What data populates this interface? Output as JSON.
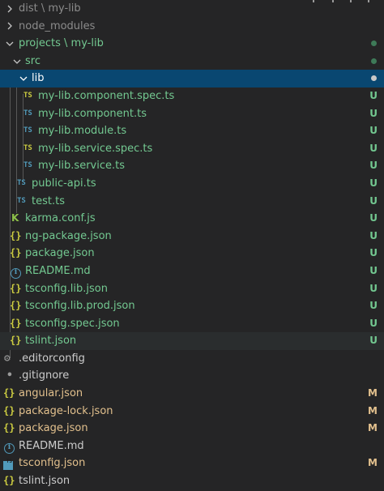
{
  "colors": {
    "background": "#252526",
    "selected": "#094771",
    "untracked": "#73c991",
    "modified": "#e2c08d",
    "ts_blue": "#519aba",
    "json_yellow": "#cbcb41"
  },
  "explorer": {
    "items": [
      {
        "label": "dist \\ my-lib",
        "type": "folder",
        "expanded": false,
        "depth": 0
      },
      {
        "label": "node_modules",
        "type": "folder",
        "expanded": false,
        "depth": 0
      },
      {
        "label": "projects \\ my-lib",
        "type": "folder",
        "expanded": true,
        "depth": 0,
        "status": "dot"
      },
      {
        "label": "src",
        "type": "folder",
        "expanded": true,
        "depth": 1,
        "status": "dot"
      },
      {
        "label": "lib",
        "type": "folder",
        "expanded": true,
        "depth": 2,
        "status": "dot",
        "selected": true
      },
      {
        "label": "my-lib.component.spec.ts",
        "icon": "typescript-icon",
        "icon_text": "TS",
        "badge": "U"
      },
      {
        "label": "my-lib.component.ts",
        "icon": "typescript-icon",
        "icon_text": "TS",
        "badge": "U"
      },
      {
        "label": "my-lib.module.ts",
        "icon": "typescript-icon",
        "icon_text": "TS",
        "badge": "U"
      },
      {
        "label": "my-lib.service.spec.ts",
        "icon": "typescript-icon",
        "icon_text": "TS",
        "badge": "U"
      },
      {
        "label": "my-lib.service.ts",
        "icon": "typescript-icon",
        "icon_text": "TS",
        "badge": "U"
      },
      {
        "label": "public-api.ts",
        "icon": "typescript-icon",
        "icon_text": "TS",
        "badge": "U"
      },
      {
        "label": "test.ts",
        "icon": "typescript-icon",
        "icon_text": "TS",
        "badge": "U"
      },
      {
        "label": "karma.conf.js",
        "icon": "karma-icon",
        "icon_text": "K",
        "badge": "U"
      },
      {
        "label": "ng-package.json",
        "icon": "json-icon",
        "icon_text": "{}",
        "badge": "U"
      },
      {
        "label": "package.json",
        "icon": "json-icon",
        "icon_text": "{}",
        "badge": "U"
      },
      {
        "label": "README.md",
        "icon": "info-icon",
        "icon_text": "i",
        "badge": "U"
      },
      {
        "label": "tsconfig.lib.json",
        "icon": "json-icon",
        "icon_text": "{}",
        "badge": "U"
      },
      {
        "label": "tsconfig.lib.prod.json",
        "icon": "json-icon",
        "icon_text": "{}",
        "badge": "U"
      },
      {
        "label": "tsconfig.spec.json",
        "icon": "json-icon",
        "icon_text": "{}",
        "badge": "U"
      },
      {
        "label": "tslint.json",
        "icon": "json-icon",
        "icon_text": "{}",
        "badge": "U"
      },
      {
        "label": ".editorconfig",
        "icon": "gear-icon",
        "icon_text": "⚙"
      },
      {
        "label": ".gitignore",
        "icon": "dot-icon",
        "icon_text": "•"
      },
      {
        "label": "angular.json",
        "icon": "json-icon",
        "icon_text": "{}",
        "badge": "M"
      },
      {
        "label": "package-lock.json",
        "icon": "json-icon",
        "icon_text": "{}",
        "badge": "M"
      },
      {
        "label": "package.json",
        "icon": "json-icon",
        "icon_text": "{}",
        "badge": "M"
      },
      {
        "label": "README.md",
        "icon": "info-icon",
        "icon_text": "i"
      },
      {
        "label": "tsconfig.json",
        "icon": "tsconfig-icon",
        "icon_text": "TS",
        "badge": "M"
      },
      {
        "label": "tslint.json",
        "icon": "json-icon",
        "icon_text": "{}"
      }
    ]
  }
}
